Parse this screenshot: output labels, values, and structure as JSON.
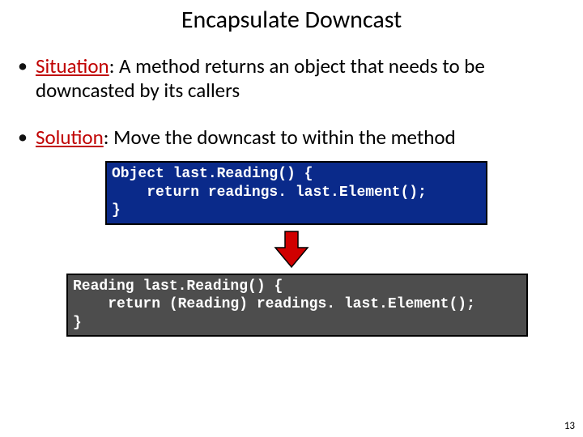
{
  "title": "Encapsulate Downcast",
  "situation": {
    "label": "Situation",
    "colon": ": ",
    "text": "A method returns an object that needs to be downcasted by its callers"
  },
  "solution": {
    "label": "Solution",
    "colon": ": ",
    "text": "Move the downcast to within the method"
  },
  "code_before": "Object last.Reading() {\n    return readings. last.Element();\n}",
  "code_after": "Reading last.Reading() {\n    return (Reading) readings. last.Element();\n}",
  "page_number": "13"
}
